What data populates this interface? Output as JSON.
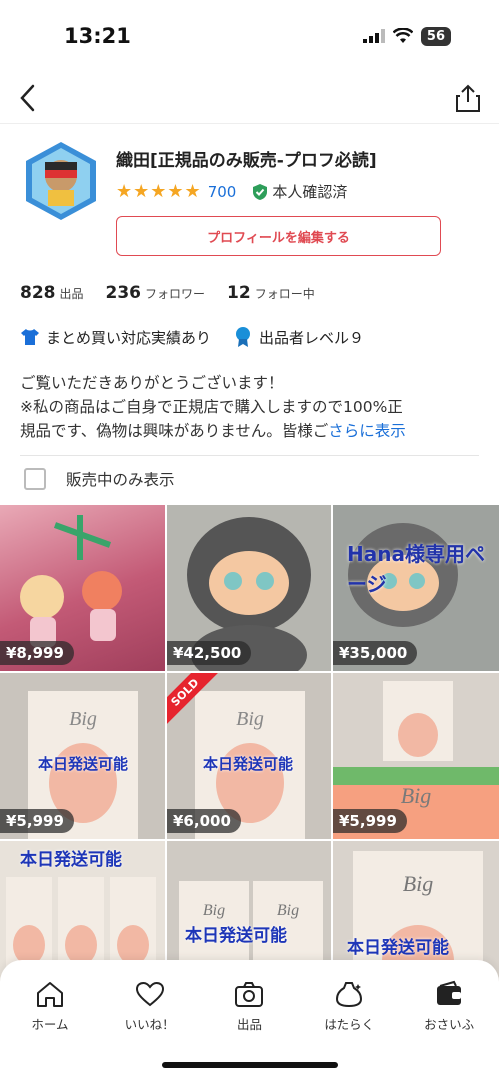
{
  "status": {
    "time": "13:21",
    "battery": "56"
  },
  "profile": {
    "name": "織田[正規品のみ販売-プロフ必読]",
    "stars": "★★★★★",
    "rating_count": "700",
    "verified": "本人確認済",
    "edit_button": "プロフィールを編集する"
  },
  "stats": [
    {
      "num": "828",
      "label": "出品"
    },
    {
      "num": "236",
      "label": "フォロワー"
    },
    {
      "num": "12",
      "label": "フォロー中"
    }
  ],
  "badges": [
    "まとめ買い対応実績あり",
    "出品者レベル９"
  ],
  "description": {
    "line1": "ご覧いただきありがとうございます！",
    "line2": "※私の商品はご自身で正規店で購入しますので100%正",
    "line3": "規品です、偽物は興味がありません。皆様ご",
    "more": "さらに表示"
  },
  "filter": {
    "label": "販売中のみ表示"
  },
  "items": [
    {
      "price": "¥8,999",
      "overlay": ""
    },
    {
      "price": "¥42,500",
      "overlay": ""
    },
    {
      "price": "¥35,000",
      "overlay": "Hana様専用ページ"
    },
    {
      "price": "¥5,999",
      "overlay": "本日発送可能"
    },
    {
      "price": "¥6,000",
      "overlay": "本日発送可能",
      "sold": "SOLD"
    },
    {
      "price": "¥5,999",
      "overlay": ""
    },
    {
      "price": "",
      "overlay": "本日発送可能"
    },
    {
      "price": "",
      "overlay": "本日発送可能"
    },
    {
      "price": "",
      "overlay": "本日発送可能"
    }
  ],
  "tabs": [
    {
      "label": "ホーム",
      "icon": "home-icon"
    },
    {
      "label": "いいね！",
      "icon": "heart-icon"
    },
    {
      "label": "出品",
      "icon": "camera-icon"
    },
    {
      "label": "はたらく",
      "icon": "work-bag-icon"
    },
    {
      "label": "おさいふ",
      "icon": "wallet-icon"
    }
  ]
}
